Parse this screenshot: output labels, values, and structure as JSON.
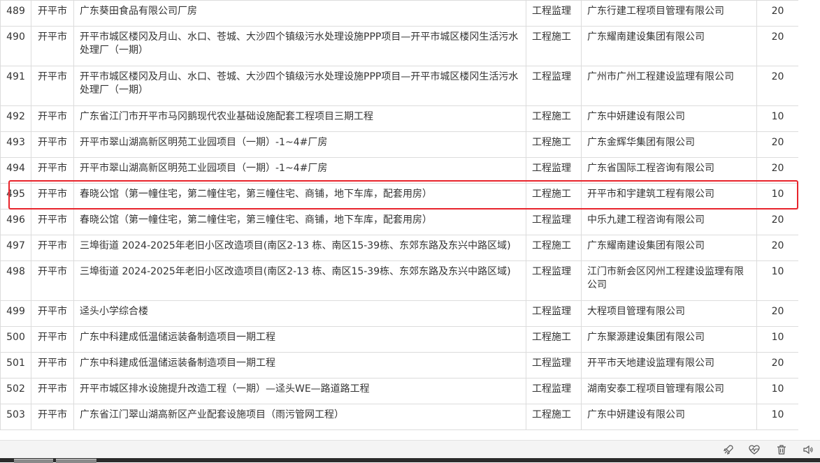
{
  "table": {
    "rows": [
      {
        "no": "489",
        "city": "开平市",
        "project": "广东葵田食品有限公司厂房",
        "type": "工程监理",
        "company": "广东行建工程项目管理有限公司",
        "score": "20",
        "tall": false
      },
      {
        "no": "490",
        "city": "开平市",
        "project": "开平市城区楼冈及月山、水口、苍城、大沙四个镇级污水处理设施PPP项目—开平市城区楼冈生活污水处理厂（一期）",
        "type": "工程施工",
        "company": "广东耀南建设集团有限公司",
        "score": "20",
        "tall": true
      },
      {
        "no": "491",
        "city": "开平市",
        "project": "开平市城区楼冈及月山、水口、苍城、大沙四个镇级污水处理设施PPP项目—开平市城区楼冈生活污水处理厂（一期）",
        "type": "工程监理",
        "company": "广州市广州工程建设监理有限公司",
        "score": "20",
        "tall": true
      },
      {
        "no": "492",
        "city": "开平市",
        "project": "广东省江门市开平市马冈鹅现代农业基础设施配套工程项目三期工程",
        "type": "工程施工",
        "company": "广东中妍建设有限公司",
        "score": "10",
        "tall": false
      },
      {
        "no": "493",
        "city": "开平市",
        "project": "开平市翠山湖高新区明苑工业园项目（一期）-1~4#厂房",
        "type": "工程施工",
        "company": "广东金辉华集团有限公司",
        "score": "20",
        "tall": false
      },
      {
        "no": "494",
        "city": "开平市",
        "project": "开平市翠山湖高新区明苑工业园项目（一期）-1~4#厂房",
        "type": "工程监理",
        "company": "广东省国际工程咨询有限公司",
        "score": "20",
        "tall": false
      },
      {
        "no": "495",
        "city": "开平市",
        "project": "春晓公馆（第一幢住宅，第二幢住宅，第三幢住宅、商铺，地下车库，配套用房）",
        "type": "工程施工",
        "company": "开平市和宇建筑工程有限公司",
        "score": "10",
        "tall": false
      },
      {
        "no": "496",
        "city": "开平市",
        "project": "春晓公馆（第一幢住宅，第二幢住宅，第三幢住宅、商铺，地下车库，配套用房）",
        "type": "工程监理",
        "company": "中乐九建工程咨询有限公司",
        "score": "20",
        "tall": false
      },
      {
        "no": "497",
        "city": "开平市",
        "project": "三埠街道 2024-2025年老旧小区改造项目(南区2-13 栋、南区15-39栋、东郊东路及东兴中路区域)",
        "type": "工程施工",
        "company": "广东耀南建设集团有限公司",
        "score": "20",
        "tall": false
      },
      {
        "no": "498",
        "city": "开平市",
        "project": "三埠街道 2024-2025年老旧小区改造项目(南区2-13 栋、南区15-39栋、东郊东路及东兴中路区域)",
        "type": "工程监理",
        "company": "江门市新会区冈州工程建设监理有限公司",
        "score": "10",
        "tall": true
      },
      {
        "no": "499",
        "city": "开平市",
        "project": "迳头小学综合楼",
        "type": "工程监理",
        "company": "大程项目管理有限公司",
        "score": "20",
        "tall": false
      },
      {
        "no": "500",
        "city": "开平市",
        "project": "广东中科建成低温储运装备制造项目一期工程",
        "type": "工程施工",
        "company": "广东聚源建设集团有限公司",
        "score": "10",
        "tall": false
      },
      {
        "no": "501",
        "city": "开平市",
        "project": "广东中科建成低温储运装备制造项目一期工程",
        "type": "工程监理",
        "company": "开平市天地建设监理有限公司",
        "score": "20",
        "tall": false
      },
      {
        "no": "502",
        "city": "开平市",
        "project": "开平市城区排水设施提升改造工程（一期）—迳头WE—路道路工程",
        "type": "工程监理",
        "company": "湖南安泰工程项目管理有限公司",
        "score": "10",
        "tall": false
      },
      {
        "no": "503",
        "city": "开平市",
        "project": "广东省江门翠山湖高新区产业配套设施项目（雨污管网工程）",
        "type": "工程施工",
        "company": "广东中妍建设有限公司",
        "score": "10",
        "tall": false
      }
    ]
  },
  "highlight": {
    "row_no": "495",
    "color": "#e8232b"
  },
  "bottom_bar": {
    "icons": [
      "rocket-icon",
      "heart-rate-icon",
      "trash-icon",
      "speaker-icon"
    ]
  },
  "colors": {
    "border": "#dcdcdc",
    "text": "#333333",
    "highlight": "#e8232b"
  }
}
